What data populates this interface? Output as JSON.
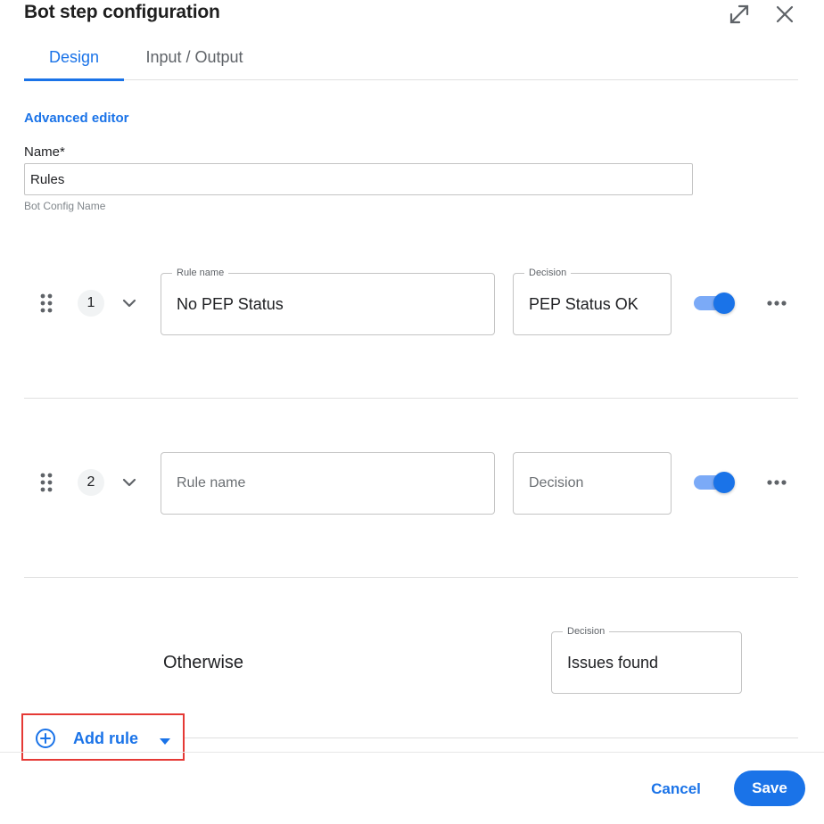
{
  "header": {
    "title": "Bot step configuration",
    "icons": [
      "expand-icon",
      "close-icon"
    ]
  },
  "tabs": [
    {
      "label": "Design",
      "active": true
    },
    {
      "label": "Input / Output",
      "active": false
    }
  ],
  "advanced_editor": {
    "label": "Advanced editor"
  },
  "name_field": {
    "label": "Name*",
    "value": "Rules",
    "helper": "Bot Config Name"
  },
  "rules": [
    {
      "number": "1",
      "rule_name_legend": "Rule name",
      "rule_name_value": "No PEP Status",
      "decision_legend": "Decision",
      "decision_value": "PEP Status OK",
      "enabled": true
    },
    {
      "number": "2",
      "rule_name_placeholder": "Rule name",
      "decision_placeholder": "Decision",
      "enabled": true
    }
  ],
  "otherwise": {
    "label": "Otherwise",
    "decision_legend": "Decision",
    "decision_value": "Issues found"
  },
  "add_rule": {
    "label": "Add rule"
  },
  "footer": {
    "cancel_label": "Cancel",
    "save_label": "Save"
  },
  "colors": {
    "accent": "#1a73e8",
    "toggle_track": "#7baaf7",
    "highlight_border": "#e53935"
  }
}
